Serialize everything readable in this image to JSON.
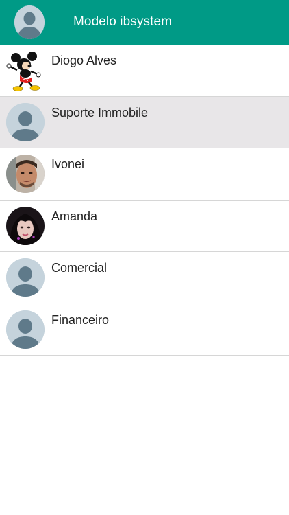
{
  "header": {
    "title": "Modelo ibsystem",
    "background_color": "#009a86",
    "avatar_icon": "default-user-icon"
  },
  "contacts": [
    {
      "name": "Diogo Alves",
      "avatar": "cartoon-mouse-avatar",
      "selected": false
    },
    {
      "name": "Suporte Immobile",
      "avatar": "default-user-icon",
      "selected": true
    },
    {
      "name": "Ivonei",
      "avatar": "photo-avatar-man",
      "selected": false
    },
    {
      "name": "Amanda",
      "avatar": "photo-avatar-woman",
      "selected": false
    },
    {
      "name": "Comercial",
      "avatar": "default-user-icon",
      "selected": false
    },
    {
      "name": "Financeiro",
      "avatar": "default-user-icon",
      "selected": false
    }
  ],
  "colors": {
    "selected_row": "#e8e6e8",
    "divider": "#d6d6d6",
    "default_avatar_bg": "#c5d3dc",
    "default_avatar_fg": "#5f7a8a"
  }
}
